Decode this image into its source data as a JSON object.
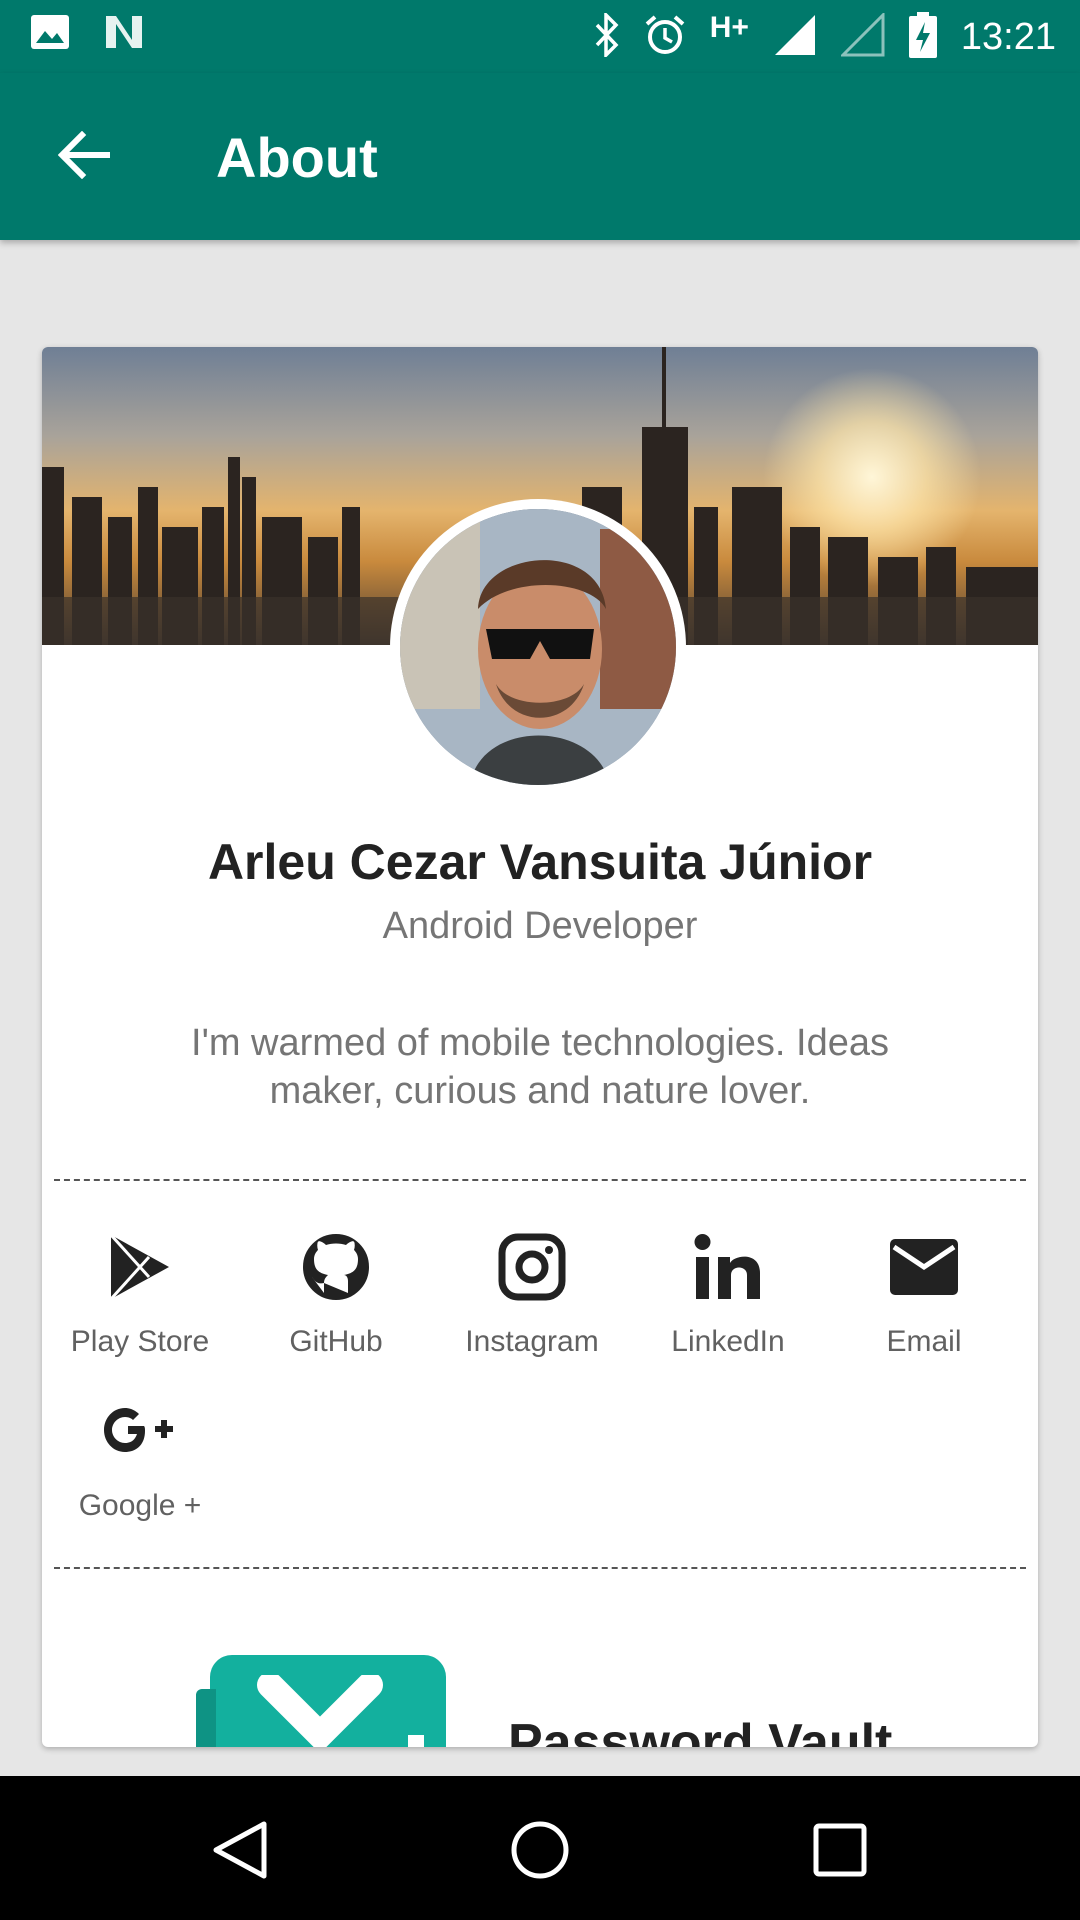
{
  "status_bar": {
    "time": "13:21",
    "network": "H+",
    "icons": [
      "image-icon",
      "n-icon",
      "bluetooth-icon",
      "alarm-icon",
      "signal-icon",
      "signal-empty-icon",
      "battery-charging-icon"
    ]
  },
  "app_bar": {
    "title": "About",
    "back_icon": "arrow-back-icon"
  },
  "profile": {
    "name": "Arleu Cezar Vansuita Júnior",
    "role": "Android Developer",
    "bio": "I'm warmed of mobile technologies. Ideas maker, curious and nature lover."
  },
  "links": [
    {
      "label": "Play Store",
      "icon": "play-store-icon"
    },
    {
      "label": "GitHub",
      "icon": "github-icon"
    },
    {
      "label": "Instagram",
      "icon": "instagram-icon"
    },
    {
      "label": "LinkedIn",
      "icon": "linkedin-icon"
    },
    {
      "label": "Email",
      "icon": "email-icon"
    },
    {
      "label": "Google +",
      "icon": "google-plus-icon"
    }
  ],
  "app_item": {
    "title": "Password Vault",
    "icon": "password-vault-icon"
  },
  "colors": {
    "primary": "#00796b",
    "app_icon": "#13b09e"
  },
  "nav_bar": {
    "icons": [
      "back-triangle-icon",
      "home-circle-icon",
      "recents-square-icon"
    ]
  }
}
